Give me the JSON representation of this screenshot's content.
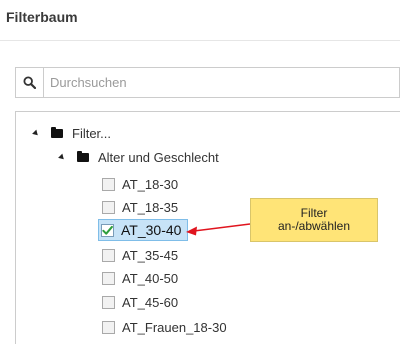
{
  "panel": {
    "title": "Filterbaum"
  },
  "search": {
    "placeholder": "Durchsuchen",
    "value": ""
  },
  "tree": {
    "root": {
      "label": "Filter..."
    },
    "group": {
      "label": "Alter und Geschlecht"
    },
    "items": [
      {
        "label": "AT_18-30",
        "checked": false
      },
      {
        "label": "AT_18-35",
        "checked": false
      },
      {
        "label": "AT_30-40",
        "checked": true
      },
      {
        "label": "AT_35-45",
        "checked": false
      },
      {
        "label": "AT_40-50",
        "checked": false
      },
      {
        "label": "AT_45-60",
        "checked": false
      },
      {
        "label": "AT_Frauen_18-30",
        "checked": false
      }
    ]
  },
  "annotation": {
    "line1": "Filter",
    "line2": "an-/abwählen"
  },
  "colors": {
    "callout_bg": "#ffe477",
    "arrow": "#e0141e",
    "selected_bg": "#c7e3f7",
    "check": "#2e9e3c"
  }
}
